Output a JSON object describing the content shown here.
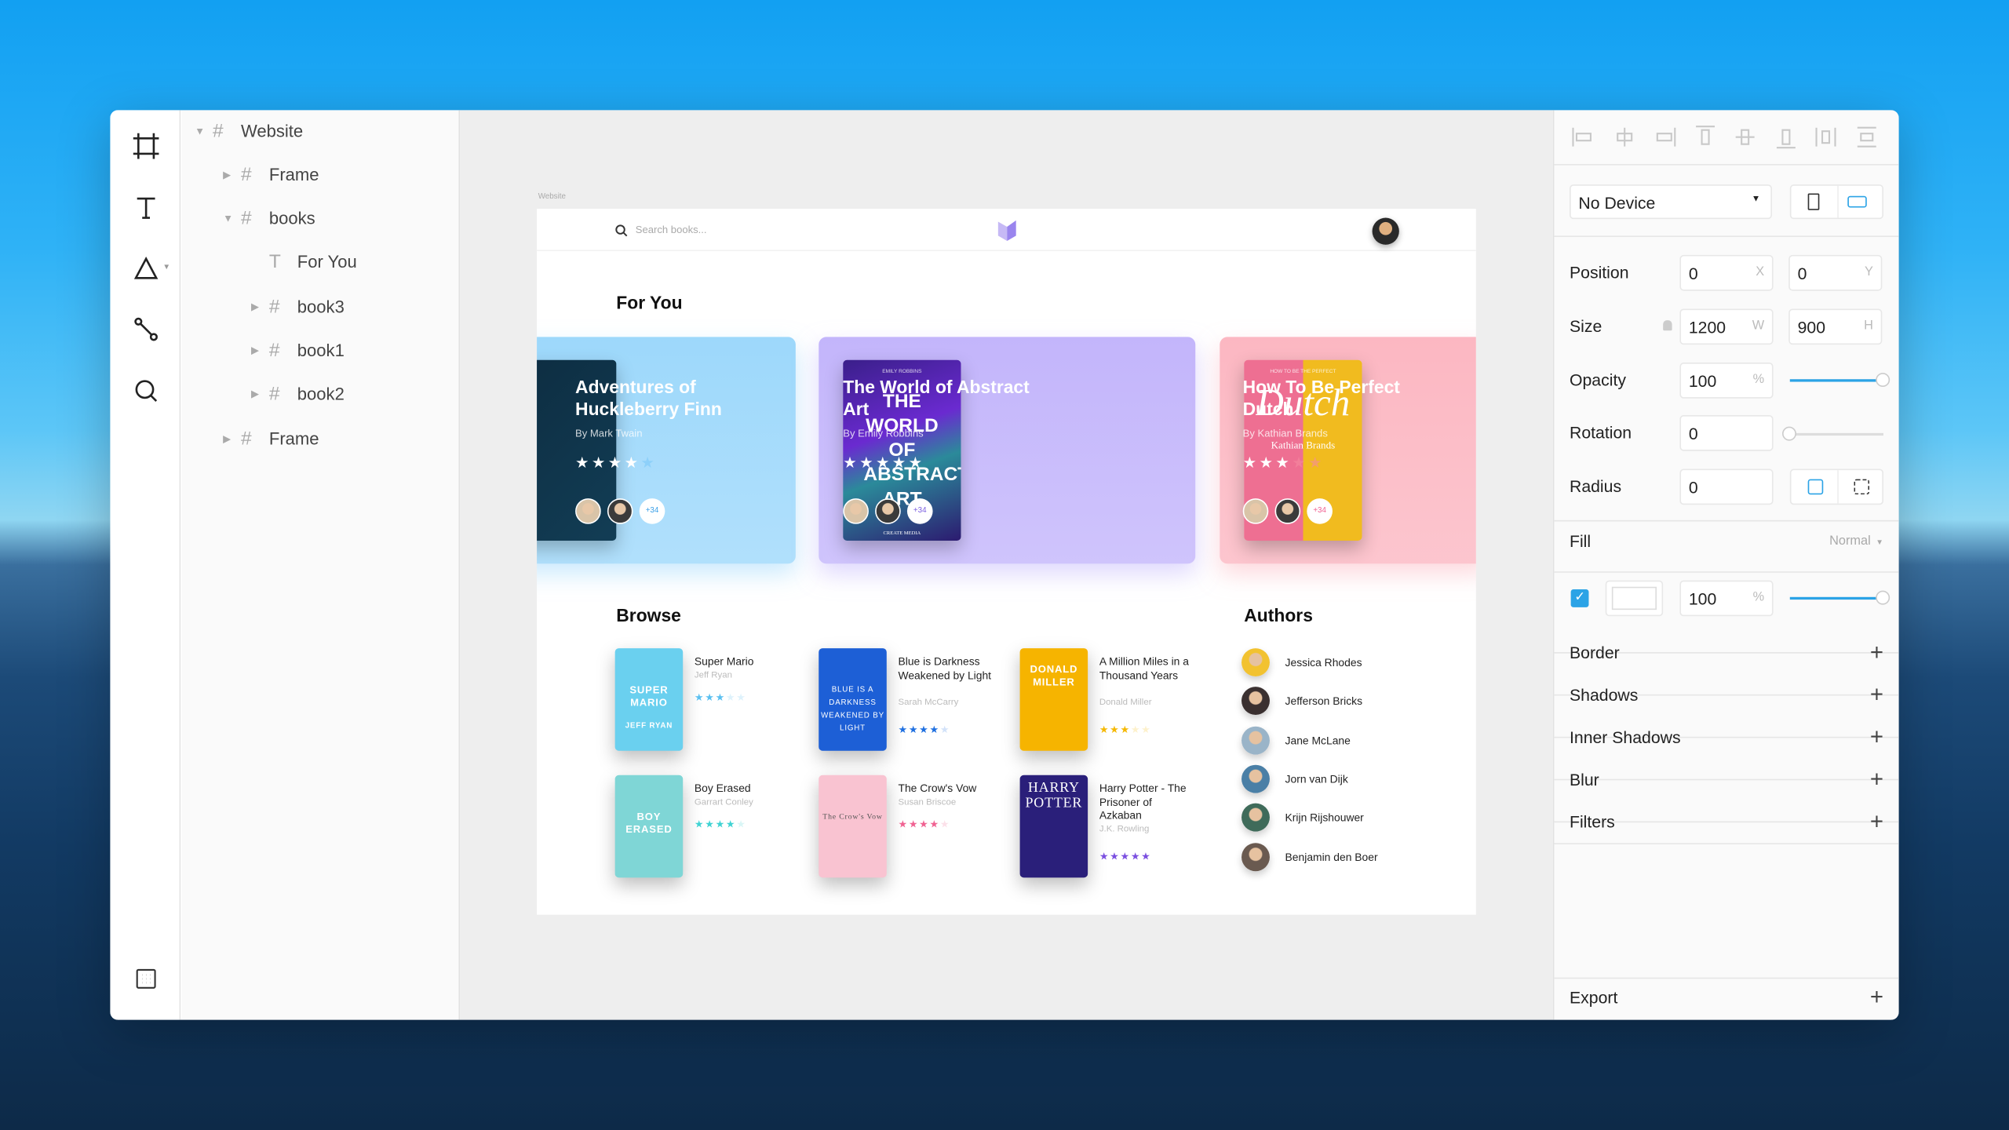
{
  "layers": {
    "items": [
      {
        "label": "Website",
        "icon": "frame-hash-icon",
        "expanded": true,
        "depth": 0
      },
      {
        "label": "Frame",
        "icon": "frame-hash-icon",
        "expanded": false,
        "depth": 1
      },
      {
        "label": "books",
        "icon": "frame-hash-icon",
        "expanded": true,
        "depth": 1
      },
      {
        "label": "For You",
        "icon": "text-icon",
        "depth": 2
      },
      {
        "label": "book3",
        "icon": "frame-hash-icon",
        "expanded": false,
        "depth": 2
      },
      {
        "label": "book1",
        "icon": "frame-hash-icon",
        "expanded": false,
        "depth": 2
      },
      {
        "label": "book2",
        "icon": "frame-hash-icon",
        "expanded": false,
        "depth": 2
      },
      {
        "label": "Frame",
        "icon": "frame-hash-icon",
        "expanded": false,
        "depth": 1
      }
    ]
  },
  "tools": [
    "frame-tool-icon",
    "text-tool-icon",
    "shape-tool-icon",
    "path-tool-icon",
    "zoom-tool-icon",
    "grid-icon"
  ],
  "canvas": {
    "artboard_label": "Website"
  },
  "site": {
    "search_placeholder": "Search books...",
    "for_you": "For You",
    "browse": "Browse",
    "authors_heading": "Authors",
    "featured": [
      {
        "title": "Adventures of Huckleberry Finn",
        "author": "By Mark Twain",
        "rating": 4,
        "more": "+34",
        "color": "#9dd8fb",
        "star_color": "#7cc8f8"
      },
      {
        "title": "The World of Abstract Art",
        "author": "By Emily Robbins",
        "rating": 5,
        "more": "+34",
        "color": "#c3b5fb",
        "star_color": "#ffffff",
        "cover_text": "THE WORLD OF ABSTRACT ART",
        "cover_top": "EMILY ROBBINS",
        "cover_bottom": "CREATE MEDIA"
      },
      {
        "title": "How To Be Perfect Dutch",
        "author": "By Kathian Brands",
        "rating": 3,
        "more": "+34",
        "color": "#fcb7c2",
        "star_color": "#f58ba0",
        "cover_text": "Dutch",
        "cover_top": "HOW TO BE THE PERFECT",
        "cover_bottom": "Kathian Brands"
      }
    ],
    "browse_items": [
      {
        "title": "Super Mario",
        "author": "Jeff Ryan",
        "rating": 3,
        "star_color": "#5bc0f0",
        "cover": "#6ad0ef",
        "cover_text": "SUPER MARIO",
        "cover_sub": "JEFF RYAN"
      },
      {
        "title": "Blue is Darkness Weakened by Light",
        "author": "Sarah McCarry",
        "rating": 4,
        "star_color": "#1e6fe0",
        "cover": "#1d5fd6",
        "cover_text": "BLUE IS A DARKNESS WEAKENED BY LIGHT"
      },
      {
        "title": "A Million Miles in a Thousand Years",
        "author": "Donald Miller",
        "rating": 3,
        "star_color": "#f5b800",
        "cover": "#f6b400",
        "cover_text": "DONALD MILLER"
      },
      {
        "title": "Boy Erased",
        "author": "Garrart Conley",
        "rating": 4,
        "star_color": "#3fd3d3",
        "cover": "#7fd6d6",
        "cover_text": "BOY ERASED"
      },
      {
        "title": "The Crow's Vow",
        "author": "Susan Briscoe",
        "rating": 4,
        "star_color": "#f06292",
        "cover": "#f9c3d1",
        "cover_text": "The Crow's Vow"
      },
      {
        "title": "Harry Potter - The Prisoner of Azkaban",
        "author": "J.K. Rowling",
        "rating": 5,
        "star_color": "#7b4fe0",
        "cover": "#2a1f7a",
        "cover_text": "HARRY POTTER"
      }
    ],
    "authors": [
      {
        "name": "Jessica Rhodes",
        "color": "#f2c230"
      },
      {
        "name": "Jefferson Bricks",
        "color": "#3a3030"
      },
      {
        "name": "Jane McLane",
        "color": "#9ab4c8"
      },
      {
        "name": "Jorn van Dijk",
        "color": "#4a7fa6"
      },
      {
        "name": "Krijn Rijshouwer",
        "color": "#3f6b5a"
      },
      {
        "name": "Benjamin den Boer",
        "color": "#6a5a50"
      }
    ]
  },
  "inspector": {
    "align_icons": [
      "align-left-icon",
      "align-center-h-icon",
      "align-right-icon",
      "align-top-icon",
      "align-middle-v-icon",
      "align-bottom-icon",
      "distribute-h-icon",
      "distribute-v-icon"
    ],
    "device": "No Device",
    "position": {
      "label": "Position",
      "x": "0",
      "y": "0",
      "x_unit": "X",
      "y_unit": "Y"
    },
    "size": {
      "label": "Size",
      "w": "1200",
      "h": "900",
      "w_unit": "W",
      "h_unit": "H"
    },
    "opacity": {
      "label": "Opacity",
      "value": "100",
      "unit": "%",
      "level": 1.0
    },
    "rotation": {
      "label": "Rotation",
      "value": "0",
      "level": 0.0
    },
    "radius": {
      "label": "Radius",
      "value": "0"
    },
    "fill": {
      "label": "Fill",
      "blend": "Normal",
      "enabled": true,
      "swatch": "#ffffff",
      "opacity": "100",
      "unit": "%",
      "level": 1.0
    },
    "sections": [
      "Border",
      "Shadows",
      "Inner Shadows",
      "Blur",
      "Filters"
    ],
    "export": "Export",
    "accent": "#2ba3e6"
  }
}
